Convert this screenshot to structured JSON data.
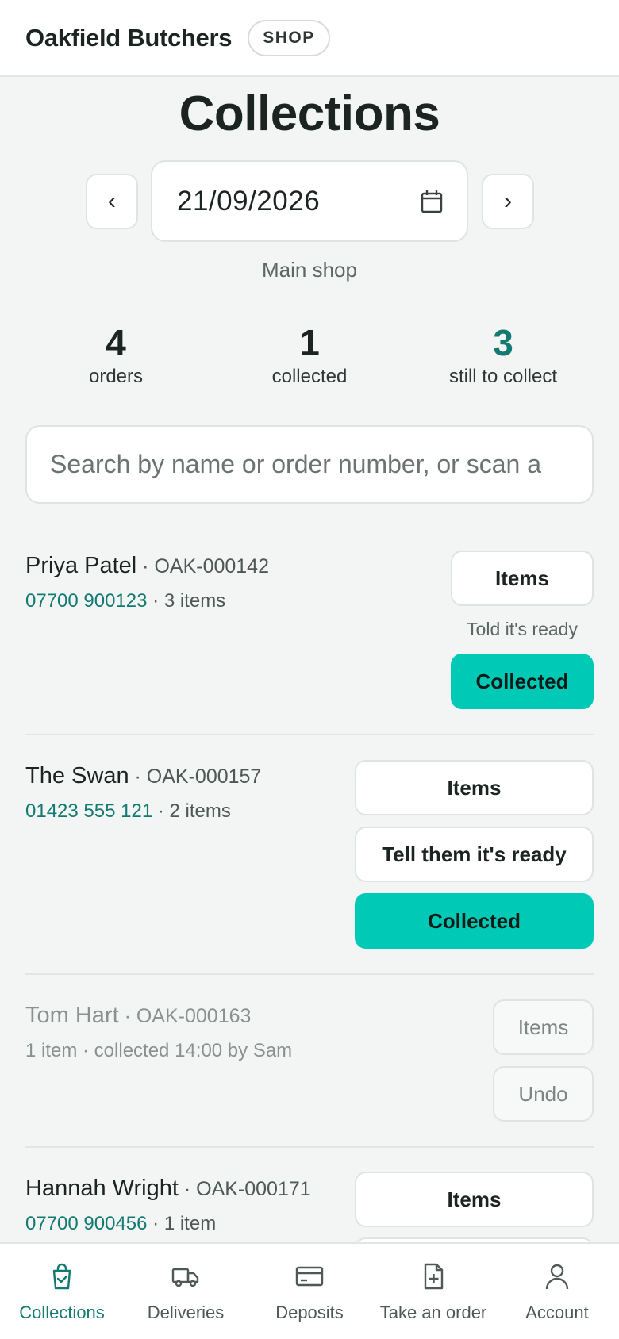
{
  "header": {
    "brand": "Oakfield Butchers",
    "badge": "SHOP"
  },
  "page": {
    "title": "Collections",
    "prev_label": "‹",
    "next_label": "›",
    "date": "21/09/2026",
    "location": "Main shop"
  },
  "stats": [
    {
      "value": "4",
      "label": "orders"
    },
    {
      "value": "1",
      "label": "collected"
    },
    {
      "value": "3",
      "label": "still to collect"
    }
  ],
  "search": {
    "placeholder": "Search by name or order number, or scan a"
  },
  "orders": [
    {
      "name": "Priya Patel",
      "id": " · OAK-000142",
      "phone": "07700 900123",
      "detail": " · 3 items",
      "items_label": "Items",
      "note": "Told it's ready",
      "action_label": "Collected"
    },
    {
      "name": "The Swan",
      "id": " · OAK-000157",
      "phone": "01423 555 121",
      "detail": " · 2 items",
      "items_label": "Items",
      "notify_label": "Tell them it's ready",
      "action_label": "Collected"
    },
    {
      "name": "Tom Hart",
      "id": " · OAK-000163",
      "detail": "1 item · collected 14:00 by Sam",
      "items_label": "Items",
      "undo_label": "Undo"
    },
    {
      "name": "Hannah Wright",
      "id": " · OAK-000171",
      "phone": "07700 900456",
      "detail": " · 1 item",
      "items_label": "Items"
    }
  ],
  "bottom_nav": [
    {
      "label": "Collections",
      "icon": "shopping-bag-check-icon",
      "active": true
    },
    {
      "label": "Deliveries",
      "icon": "truck-icon"
    },
    {
      "label": "Deposits",
      "icon": "credit-card-icon"
    },
    {
      "label": "Take an order",
      "icon": "document-plus-icon"
    },
    {
      "label": "Account",
      "icon": "user-icon"
    }
  ],
  "colors": {
    "accent": "#00c9b6",
    "accent_text": "#137a72",
    "background": "#f3f5f4"
  }
}
